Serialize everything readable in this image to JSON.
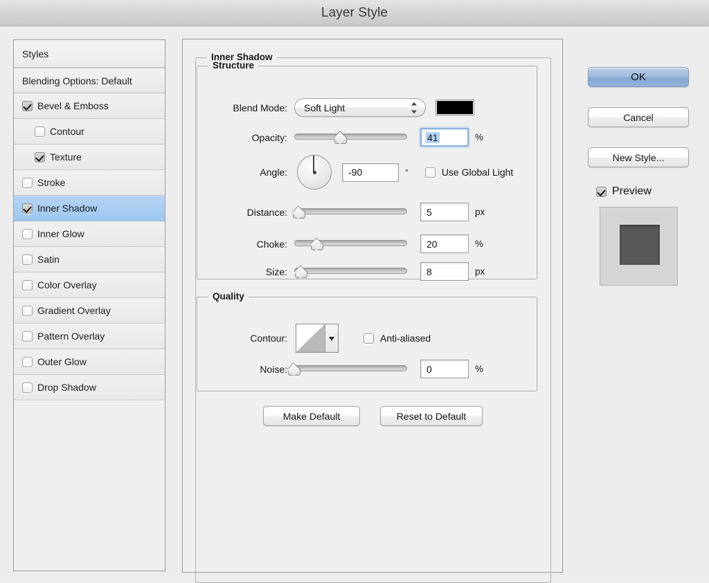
{
  "window": {
    "title": "Layer Style"
  },
  "sidebar": {
    "styles_header": "Styles",
    "blending_options": "Blending Options: Default",
    "effects": [
      {
        "label": "Bevel & Emboss",
        "checked": true,
        "indent": false,
        "selected": false
      },
      {
        "label": "Contour",
        "checked": false,
        "indent": true,
        "selected": false
      },
      {
        "label": "Texture",
        "checked": true,
        "indent": true,
        "selected": false
      },
      {
        "label": "Stroke",
        "checked": false,
        "indent": false,
        "selected": false
      },
      {
        "label": "Inner Shadow",
        "checked": true,
        "indent": false,
        "selected": true
      },
      {
        "label": "Inner Glow",
        "checked": false,
        "indent": false,
        "selected": false
      },
      {
        "label": "Satin",
        "checked": false,
        "indent": false,
        "selected": false
      },
      {
        "label": "Color Overlay",
        "checked": false,
        "indent": false,
        "selected": false
      },
      {
        "label": "Gradient Overlay",
        "checked": false,
        "indent": false,
        "selected": false
      },
      {
        "label": "Pattern Overlay",
        "checked": false,
        "indent": false,
        "selected": false
      },
      {
        "label": "Outer Glow",
        "checked": false,
        "indent": false,
        "selected": false
      },
      {
        "label": "Drop Shadow",
        "checked": false,
        "indent": false,
        "selected": false
      }
    ],
    "selection_color": "#9ec7ef"
  },
  "main": {
    "effect_title": "Inner Shadow",
    "structure": {
      "title": "Structure",
      "blend_mode": {
        "label": "Blend Mode:",
        "value": "Soft Light",
        "color_swatch": "#000000"
      },
      "opacity": {
        "label": "Opacity:",
        "value": "41",
        "unit": "%",
        "slider_percent": 41,
        "focused": true,
        "selected_text": true
      },
      "angle": {
        "label": "Angle:",
        "value": "-90",
        "unit": "°",
        "dial_degrees": -90,
        "use_global_light": {
          "label": "Use Global Light",
          "checked": false
        }
      },
      "distance": {
        "label": "Distance:",
        "value": "5",
        "unit": "px",
        "slider_percent": 4
      },
      "choke": {
        "label": "Choke:",
        "value": "20",
        "unit": "%",
        "slider_percent": 20
      },
      "size": {
        "label": "Size:",
        "value": "8",
        "unit": "px",
        "slider_percent": 6
      }
    },
    "quality": {
      "title": "Quality",
      "contour": {
        "label": "Contour:",
        "anti_aliased": {
          "label": "Anti-aliased",
          "checked": false
        }
      },
      "noise": {
        "label": "Noise:",
        "value": "0",
        "unit": "%",
        "slider_percent": 0
      }
    },
    "make_default_label": "Make Default",
    "reset_default_label": "Reset to Default"
  },
  "right": {
    "ok_label": "OK",
    "cancel_label": "Cancel",
    "new_style_label": "New Style...",
    "preview": {
      "label": "Preview",
      "checked": true
    }
  }
}
